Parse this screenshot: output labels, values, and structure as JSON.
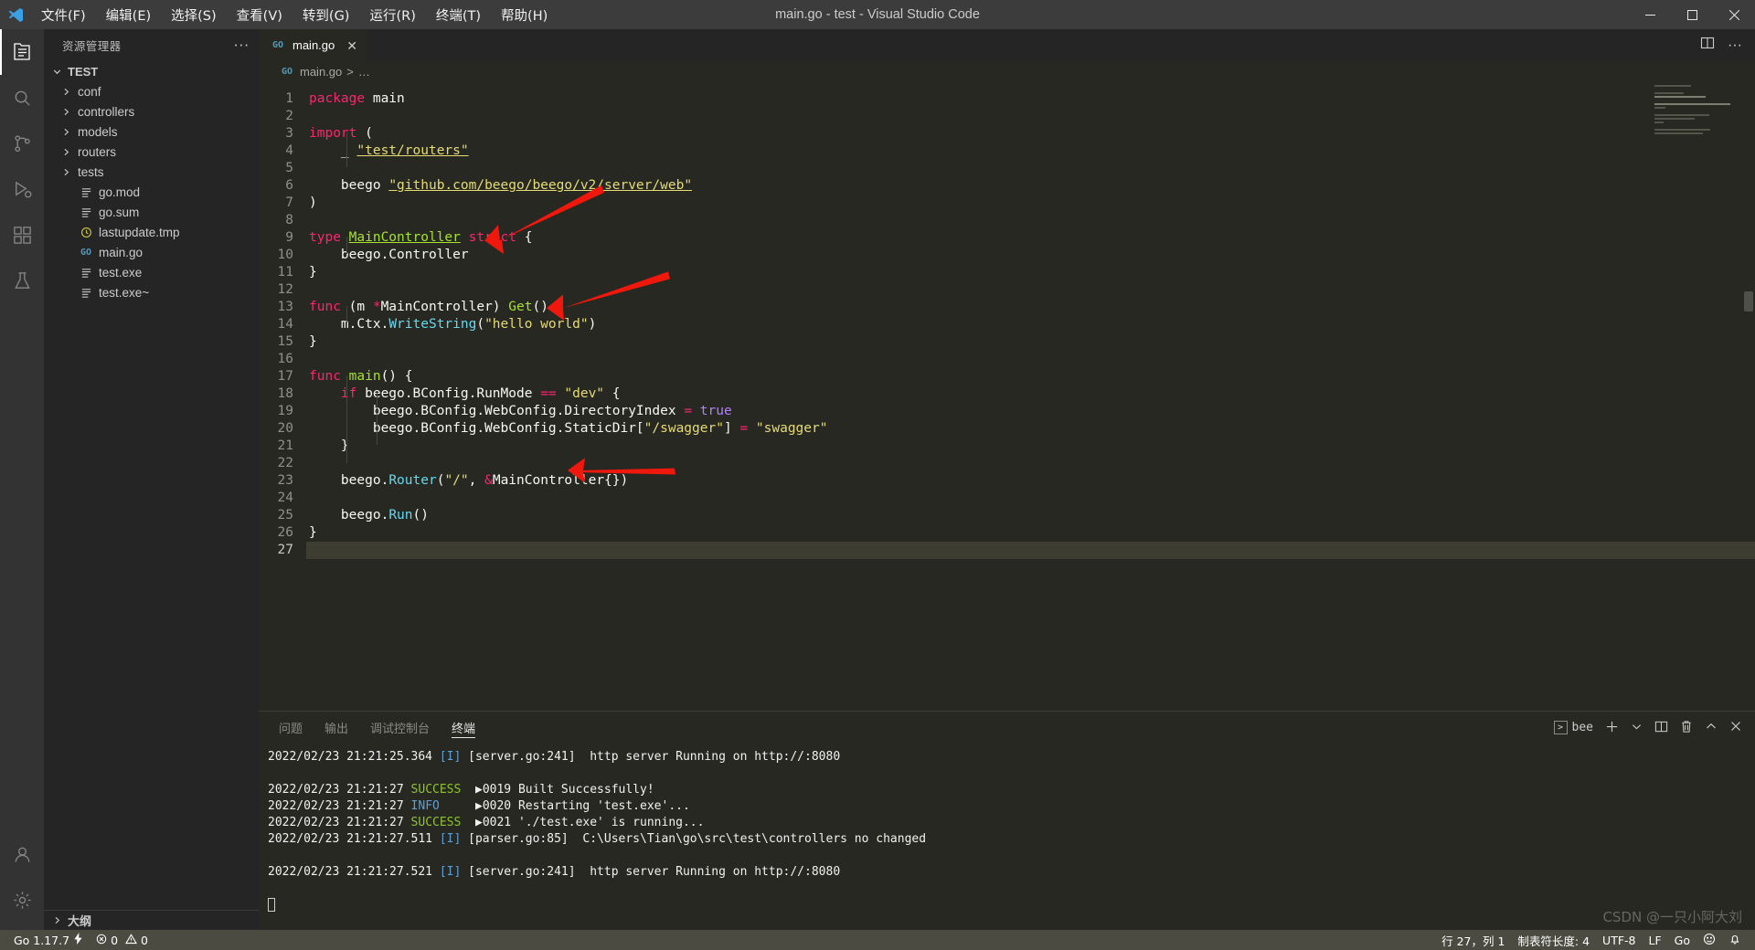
{
  "titlebar": {
    "logo": "vscode-logo",
    "menu": [
      "文件(F)",
      "编辑(E)",
      "选择(S)",
      "查看(V)",
      "转到(G)",
      "运行(R)",
      "终端(T)",
      "帮助(H)"
    ],
    "window_title": "main.go - test - Visual Studio Code",
    "controls": {
      "minimize": "—",
      "maximize": "▢",
      "close": "✕"
    }
  },
  "activitybar": {
    "items": [
      {
        "name": "explorer",
        "glyph": "files-icon",
        "active": true
      },
      {
        "name": "search",
        "glyph": "search-icon",
        "active": false
      },
      {
        "name": "source-control",
        "glyph": "source-control-icon",
        "active": false
      },
      {
        "name": "run-debug",
        "glyph": "run-debug-icon",
        "active": false
      },
      {
        "name": "extensions",
        "glyph": "extensions-icon",
        "active": false
      },
      {
        "name": "testing",
        "glyph": "beaker-icon",
        "active": false
      }
    ],
    "bottom": [
      {
        "name": "accounts",
        "glyph": "account-icon"
      },
      {
        "name": "settings",
        "glyph": "gear-icon"
      }
    ]
  },
  "sidebar": {
    "header": "资源管理器",
    "more_actions": "···",
    "root": {
      "label": "TEST",
      "expanded": true
    },
    "tree": [
      {
        "label": "conf",
        "type": "folder",
        "expanded": false
      },
      {
        "label": "controllers",
        "type": "folder",
        "expanded": false
      },
      {
        "label": "models",
        "type": "folder",
        "expanded": false
      },
      {
        "label": "routers",
        "type": "folder",
        "expanded": false
      },
      {
        "label": "tests",
        "type": "folder",
        "expanded": false
      },
      {
        "label": "go.mod",
        "type": "file",
        "icon": "lines-icon"
      },
      {
        "label": "go.sum",
        "type": "file",
        "icon": "lines-icon"
      },
      {
        "label": "lastupdate.tmp",
        "type": "file",
        "icon": "clock-icon"
      },
      {
        "label": "main.go",
        "type": "file",
        "icon": "go-icon"
      },
      {
        "label": "test.exe",
        "type": "file",
        "icon": "lines-icon"
      },
      {
        "label": "test.exe~",
        "type": "file",
        "icon": "lines-icon"
      }
    ],
    "outline": "大纲"
  },
  "editor": {
    "tab": {
      "label": "main.go",
      "icon": "go-icon",
      "close": "✕"
    },
    "tabbar_actions": [
      "split-editor-icon",
      "more-actions-icon"
    ],
    "breadcrumb": [
      "main.go",
      "…"
    ],
    "total_lines": 27,
    "current_line": 27,
    "code": [
      {
        "n": 1,
        "tokens": [
          {
            "t": "kw",
            "v": "package"
          },
          {
            "t": "pl",
            "v": " main"
          }
        ]
      },
      {
        "n": 2,
        "tokens": []
      },
      {
        "n": 3,
        "tokens": [
          {
            "t": "kw",
            "v": "import"
          },
          {
            "t": "pl",
            "v": " ("
          }
        ]
      },
      {
        "n": 4,
        "tokens": [
          {
            "t": "pl",
            "v": "    _ "
          },
          {
            "t": "str",
            "v": "\"test/routers\"",
            "u": "yellow"
          }
        ]
      },
      {
        "n": 5,
        "tokens": []
      },
      {
        "n": 6,
        "tokens": [
          {
            "t": "pl",
            "v": "    beego "
          },
          {
            "t": "str",
            "v": "\"github.com/beego/beego/v2/server/web\"",
            "u": "yellow"
          }
        ]
      },
      {
        "n": 7,
        "tokens": [
          {
            "t": "pl",
            "v": ")"
          }
        ]
      },
      {
        "n": 8,
        "tokens": []
      },
      {
        "n": 9,
        "tokens": [
          {
            "t": "kw",
            "v": "type"
          },
          {
            "t": "pl",
            "v": " "
          },
          {
            "t": "type",
            "v": "MainController",
            "u": "green"
          },
          {
            "t": "pl",
            "v": " "
          },
          {
            "t": "kw",
            "v": "struct"
          },
          {
            "t": "pl",
            "v": " {"
          }
        ]
      },
      {
        "n": 10,
        "tokens": [
          {
            "t": "pl",
            "v": "    beego.Controller"
          }
        ]
      },
      {
        "n": 11,
        "tokens": [
          {
            "t": "pl",
            "v": "}"
          }
        ]
      },
      {
        "n": 12,
        "tokens": []
      },
      {
        "n": 13,
        "tokens": [
          {
            "t": "kw",
            "v": "func"
          },
          {
            "t": "pl",
            "v": " (m "
          },
          {
            "t": "op",
            "v": "*"
          },
          {
            "t": "pl",
            "v": "MainController) "
          },
          {
            "t": "fn",
            "v": "Get"
          },
          {
            "t": "pl",
            "v": "() {"
          }
        ]
      },
      {
        "n": 14,
        "tokens": [
          {
            "t": "pl",
            "v": "    m.Ctx."
          },
          {
            "t": "mth",
            "v": "WriteString"
          },
          {
            "t": "pl",
            "v": "("
          },
          {
            "t": "str",
            "v": "\"hello world\""
          },
          {
            "t": "pl",
            "v": ")"
          }
        ]
      },
      {
        "n": 15,
        "tokens": [
          {
            "t": "pl",
            "v": "}"
          }
        ]
      },
      {
        "n": 16,
        "tokens": []
      },
      {
        "n": 17,
        "tokens": [
          {
            "t": "kw",
            "v": "func"
          },
          {
            "t": "pl",
            "v": " "
          },
          {
            "t": "fn",
            "v": "main"
          },
          {
            "t": "pl",
            "v": "() {"
          }
        ]
      },
      {
        "n": 18,
        "tokens": [
          {
            "t": "pl",
            "v": "    "
          },
          {
            "t": "kw",
            "v": "if"
          },
          {
            "t": "pl",
            "v": " beego.BConfig.RunMode "
          },
          {
            "t": "op",
            "v": "=="
          },
          {
            "t": "pl",
            "v": " "
          },
          {
            "t": "str",
            "v": "\"dev\""
          },
          {
            "t": "pl",
            "v": " {"
          }
        ]
      },
      {
        "n": 19,
        "tokens": [
          {
            "t": "pl",
            "v": "        beego.BConfig.WebConfig.DirectoryIndex "
          },
          {
            "t": "op",
            "v": "="
          },
          {
            "t": "pl",
            "v": " "
          },
          {
            "t": "num",
            "v": "true"
          }
        ]
      },
      {
        "n": 20,
        "tokens": [
          {
            "t": "pl",
            "v": "        beego.BConfig.WebConfig.StaticDir["
          },
          {
            "t": "str",
            "v": "\"/swagger\""
          },
          {
            "t": "pl",
            "v": "] "
          },
          {
            "t": "op",
            "v": "="
          },
          {
            "t": "pl",
            "v": " "
          },
          {
            "t": "str",
            "v": "\"swagger\""
          }
        ]
      },
      {
        "n": 21,
        "tokens": [
          {
            "t": "pl",
            "v": "    }"
          }
        ]
      },
      {
        "n": 22,
        "tokens": []
      },
      {
        "n": 23,
        "tokens": [
          {
            "t": "pl",
            "v": "    beego."
          },
          {
            "t": "mth",
            "v": "Router"
          },
          {
            "t": "pl",
            "v": "("
          },
          {
            "t": "str",
            "v": "\"/\""
          },
          {
            "t": "pl",
            "v": ", "
          },
          {
            "t": "op",
            "v": "&"
          },
          {
            "t": "pl",
            "v": "MainController{})"
          }
        ]
      },
      {
        "n": 24,
        "tokens": []
      },
      {
        "n": 25,
        "tokens": [
          {
            "t": "pl",
            "v": "    beego."
          },
          {
            "t": "mth",
            "v": "Run"
          },
          {
            "t": "pl",
            "v": "()"
          }
        ]
      },
      {
        "n": 26,
        "tokens": [
          {
            "t": "pl",
            "v": "}"
          }
        ]
      },
      {
        "n": 27,
        "tokens": [],
        "current": true
      }
    ],
    "annotations": [
      {
        "name": "arrow-to-beego-controller",
        "color": "#f01f14"
      },
      {
        "name": "arrow-to-get-method",
        "color": "#f01f14"
      },
      {
        "name": "arrow-to-router-call",
        "color": "#f01f14"
      }
    ]
  },
  "panel": {
    "tabs": [
      {
        "label": "问题",
        "active": false
      },
      {
        "label": "输出",
        "active": false
      },
      {
        "label": "调试控制台",
        "active": false
      },
      {
        "label": "终端",
        "active": true
      }
    ],
    "terminal_name": "bee",
    "actions": [
      "new-terminal-icon",
      "chevron-down-icon",
      "split-terminal-icon",
      "trash-icon",
      "chevron-up-icon",
      "close-icon"
    ],
    "terminal_lines": [
      {
        "parts": [
          {
            "c": "white",
            "v": "2022/02/23 21:21:25.364 "
          },
          {
            "c": "blue",
            "v": "[I]"
          },
          {
            "c": "white",
            "v": " [server.go:241]  http server Running on http://:8080"
          }
        ]
      },
      {
        "parts": []
      },
      {
        "parts": [
          {
            "c": "white",
            "v": "2022/02/23 21:21:27 "
          },
          {
            "c": "green",
            "v": "SUCCESS"
          },
          {
            "c": "white",
            "v": "  ▶0019 Built Successfully!"
          }
        ]
      },
      {
        "parts": [
          {
            "c": "white",
            "v": "2022/02/23 21:21:27 "
          },
          {
            "c": "blue",
            "v": "INFO"
          },
          {
            "c": "white",
            "v": "     ▶0020 Restarting 'test.exe'..."
          }
        ]
      },
      {
        "parts": [
          {
            "c": "white",
            "v": "2022/02/23 21:21:27 "
          },
          {
            "c": "green",
            "v": "SUCCESS"
          },
          {
            "c": "white",
            "v": "  ▶0021 './test.exe' is running..."
          }
        ]
      },
      {
        "parts": [
          {
            "c": "white",
            "v": "2022/02/23 21:21:27.511 "
          },
          {
            "c": "blue",
            "v": "[I]"
          },
          {
            "c": "white",
            "v": " [parser.go:85]  C:\\Users\\Tian\\go\\src\\test\\controllers no changed"
          }
        ]
      },
      {
        "parts": []
      },
      {
        "parts": [
          {
            "c": "white",
            "v": "2022/02/23 21:21:27.521 "
          },
          {
            "c": "blue",
            "v": "[I]"
          },
          {
            "c": "white",
            "v": " [server.go:241]  http server Running on http://:8080"
          }
        ]
      },
      {
        "parts": []
      },
      {
        "parts": [],
        "cursor": true
      }
    ]
  },
  "statusbar": {
    "left": [
      {
        "name": "go-version",
        "label": "Go 1.17.7",
        "icon": "lightning-icon"
      },
      {
        "name": "problems",
        "label": "0  0",
        "icon": "error-warning-icon"
      }
    ],
    "right": [
      {
        "name": "cursor-position",
        "label": "行 27，列 1"
      },
      {
        "name": "indentation",
        "label": "制表符长度: 4"
      },
      {
        "name": "encoding",
        "label": "UTF-8"
      },
      {
        "name": "eol",
        "label": "LF"
      },
      {
        "name": "language-mode",
        "label": "Go"
      },
      {
        "name": "feedback",
        "label": "",
        "icon": "smiley-icon"
      },
      {
        "name": "notifications",
        "label": "",
        "icon": "bell-icon"
      }
    ]
  },
  "watermark": "CSDN @一只小阿大刘"
}
